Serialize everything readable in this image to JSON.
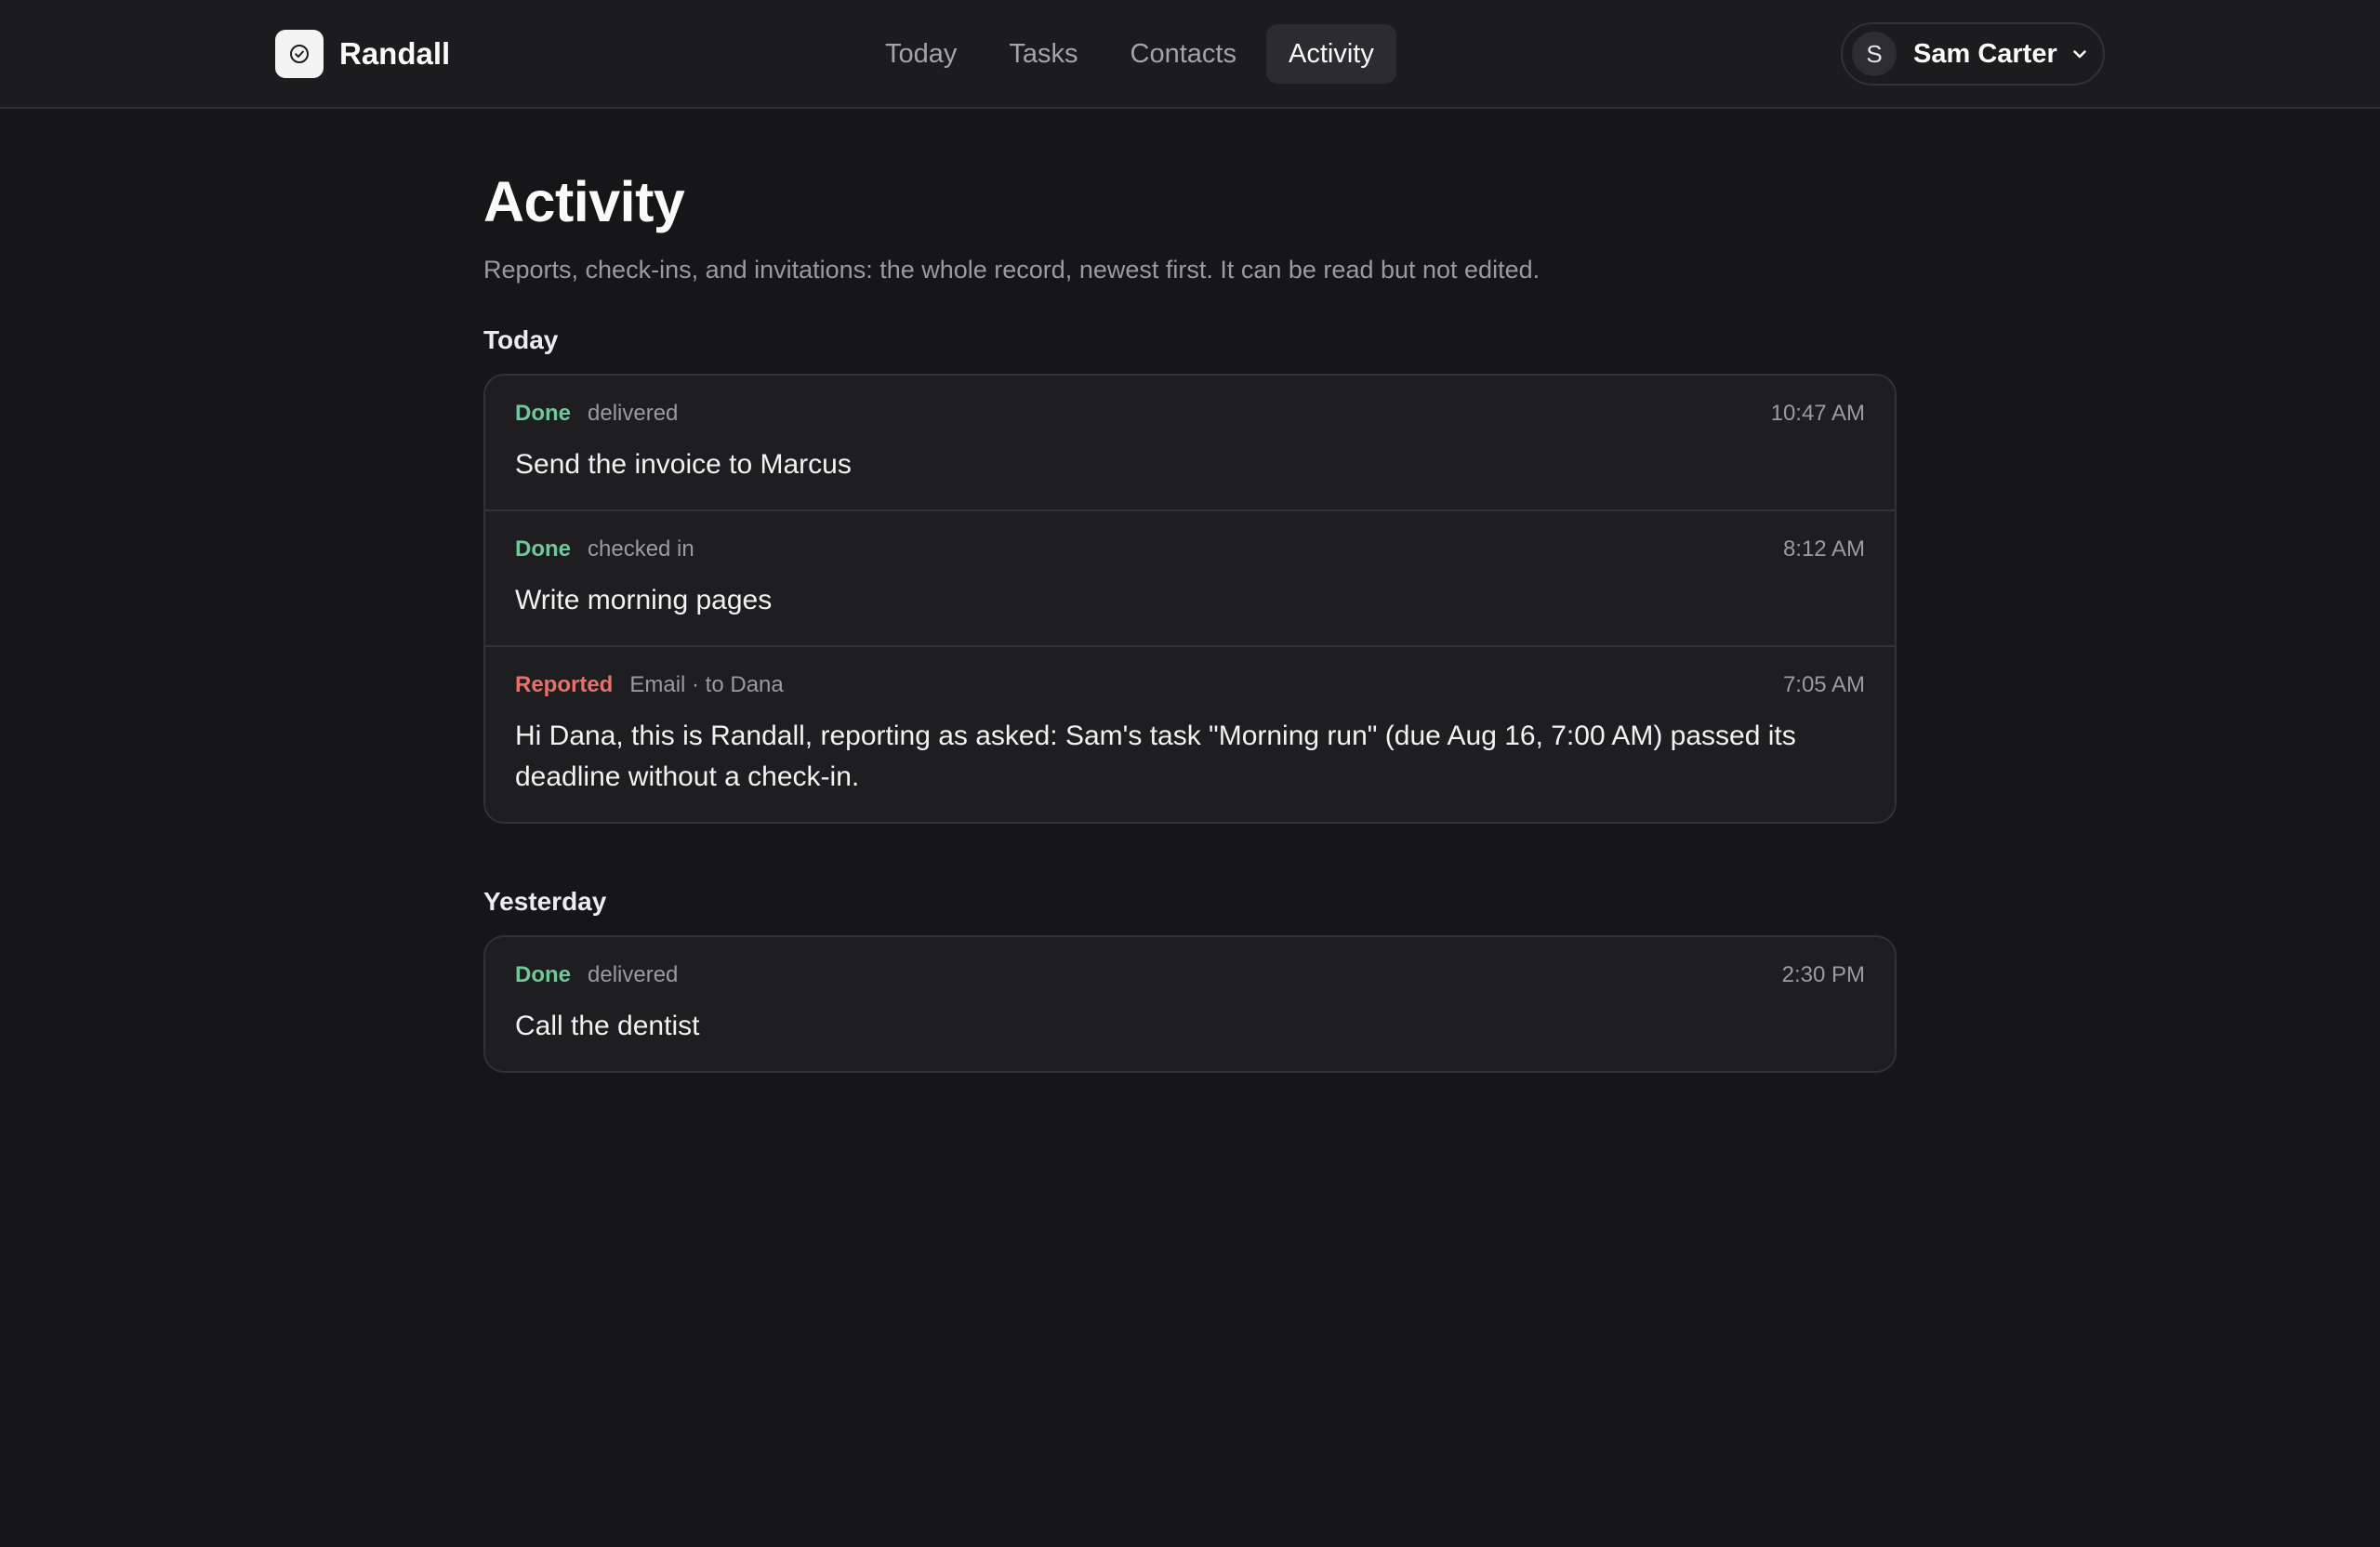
{
  "app": {
    "name": "Randall"
  },
  "nav": {
    "tabs": [
      {
        "label": "Today"
      },
      {
        "label": "Tasks"
      },
      {
        "label": "Contacts"
      },
      {
        "label": "Activity",
        "active": true
      }
    ]
  },
  "user": {
    "initial": "S",
    "name": "Sam Carter"
  },
  "page": {
    "title": "Activity",
    "subtitle": "Reports, check-ins, and invitations: the whole record, newest first. It can be read but not edited."
  },
  "groups": [
    {
      "label": "Today",
      "entries": [
        {
          "status": "Done",
          "detail": "delivered",
          "time": "10:47 AM",
          "text": "Send the invoice to Marcus"
        },
        {
          "status": "Done",
          "detail": "checked in",
          "time": "8:12 AM",
          "text": "Write morning pages"
        },
        {
          "status": "Reported",
          "detail": "Email · to Dana",
          "time": "7:05 AM",
          "text": "Hi Dana, this is Randall, reporting as asked: Sam's task \"Morning run\" (due Aug 16, 7:00 AM) passed its deadline without a check-in."
        }
      ]
    },
    {
      "label": "Yesterday",
      "entries": [
        {
          "status": "Done",
          "detail": "delivered",
          "time": "2:30 PM",
          "text": "Call the dentist"
        }
      ]
    }
  ],
  "icons": {
    "logo": "check-circle-icon",
    "user_menu": "chevron-down-icon"
  },
  "colors": {
    "done": "#6fc79a",
    "reported": "#e9706a",
    "background": "#161618"
  }
}
